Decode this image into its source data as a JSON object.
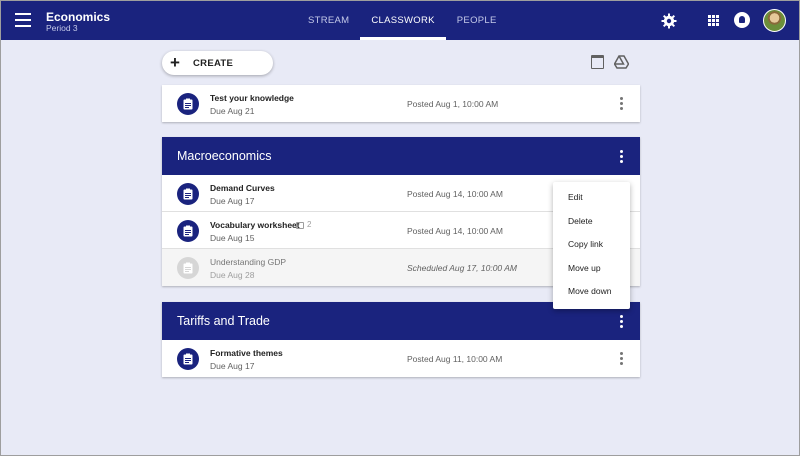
{
  "header": {
    "course_title": "Economics",
    "course_subtitle": "Period 3",
    "tabs": [
      {
        "label": "STREAM",
        "active": false
      },
      {
        "label": "CLASSWORK",
        "active": true
      },
      {
        "label": "PEOPLE",
        "active": false
      }
    ],
    "icons": [
      "menu-icon",
      "gear-icon",
      "apps-icon",
      "notification-icon",
      "avatar"
    ]
  },
  "toolbar": {
    "create_label": "CREATE",
    "create_icon": "+",
    "icons": [
      "calendar-icon",
      "drive-icon"
    ]
  },
  "standalone": {
    "title": "Test your knowledge",
    "due": "Due Aug 21",
    "posted": "Posted Aug 1, 10:00 AM"
  },
  "topics": [
    {
      "title": "Macroeconomics",
      "items": [
        {
          "title": "Demand Curves",
          "due": "Due Aug 17",
          "posted": "Posted Aug 14, 10:00 AM"
        },
        {
          "title": "Vocabulary worksheet",
          "due": "Due Aug 15",
          "posted": "Posted Aug 14, 10:00 AM",
          "comments": "2"
        },
        {
          "title": "Understanding GDP",
          "due": "Due Aug 28",
          "posted": "Scheduled Aug 17, 10:00 AM",
          "scheduled": true
        }
      ]
    },
    {
      "title": "Tariffs and Trade",
      "items": [
        {
          "title": "Formative themes",
          "due": "Due Aug 17",
          "posted": "Posted Aug 11, 10:00 AM"
        }
      ]
    }
  ],
  "context_menu": [
    "Edit",
    "Delete",
    "Copy link",
    "Move up",
    "Move down"
  ],
  "colors": {
    "primary": "#1a237e",
    "background": "#e8eaf6",
    "scheduled_row": "#f5f5f5"
  }
}
